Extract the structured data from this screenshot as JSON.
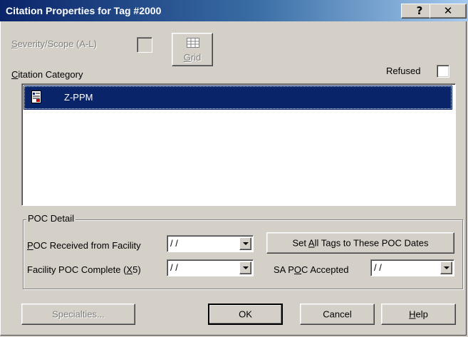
{
  "window": {
    "title": "Citation Properties for Tag #2000",
    "help_button": "?",
    "close_button": "✕"
  },
  "severity": {
    "label_pre": "",
    "label_u": "S",
    "label_post": "everity/Scope (A-L)"
  },
  "grid_button": {
    "label_u": "G",
    "label_post": "rid"
  },
  "category": {
    "label_u": "C",
    "label_post": "itation Category",
    "items": [
      "Z-PPM"
    ]
  },
  "refused": {
    "label": "Refused"
  },
  "poc": {
    "legend": "POC Detail",
    "received_label_u": "P",
    "received_label_post": "OC Received from Facility",
    "received_value": "/ /",
    "complete_label_pre": "Facility POC Complete (",
    "complete_label_u": "X",
    "complete_label_post": "5)",
    "complete_value": "/ /",
    "set_all_pre": "Set ",
    "set_all_u": "A",
    "set_all_post": "ll Tags to These POC Dates",
    "accepted_label_pre": "SA P",
    "accepted_label_u": "O",
    "accepted_label_post": "C Accepted",
    "accepted_value": "/ /"
  },
  "footer": {
    "specialties": "Specialties...",
    "ok": "OK",
    "cancel": "Cancel",
    "help_u": "H",
    "help_post": "elp"
  }
}
